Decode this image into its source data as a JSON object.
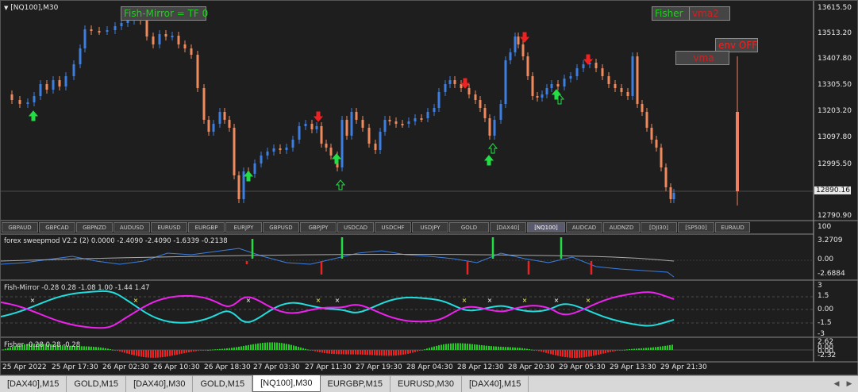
{
  "chart": {
    "title": "[NQ100],M30",
    "current_price": "12890.16",
    "price_axis": [
      "13615.50",
      "13513.20",
      "13407.80",
      "13305.50",
      "13203.20",
      "13097.80",
      "12995.50",
      "12890.16",
      "12790.90"
    ],
    "time_axis": [
      "25 Apr 2022",
      "25 Apr 17:30",
      "26 Apr 02:30",
      "26 Apr 10:30",
      "26 Apr 18:30",
      "27 Apr 03:30",
      "27 Apr 11:30",
      "27 Apr 19:30",
      "28 Apr 04:30",
      "28 Apr 12:30",
      "28 Apr 20:30",
      "29 Apr 05:30",
      "29 Apr 13:30",
      "29 Apr 21:30"
    ],
    "labels": {
      "fish_mirror": "Fish-Mirror = TF 0",
      "fisher": "Fisher",
      "vma2": "vma2",
      "env": "env OFF",
      "vma": "vma"
    },
    "colors": {
      "bull": "#3d7fe0",
      "bear": "#f08a5d",
      "up_arrow": "#22dd44",
      "down_arrow": "#ee2222"
    }
  },
  "symbols": [
    "GBPAUD",
    "GBPCAD",
    "GBPNZD",
    "AUDUSD",
    "EURUSD",
    "EURGBP",
    "EURJPY",
    "GBPUSD",
    "GBPJPY",
    "USDCAD",
    "USDCHF",
    "USDJPY",
    "GOLD",
    "[DAX40]",
    "[NQ100]",
    "AUDCAD",
    "AUDNZD",
    "[DJI30]",
    "[SP500]",
    "EURAUD"
  ],
  "active_symbol": "[NQ100]",
  "indicators": {
    "sweep": {
      "title": "forex sweepmod V2.2 (2) 0.0000 -2.4090 -2.4090 -1.6339 -0.2138",
      "axis": [
        "100",
        "3.2709",
        "0.00",
        "-2.6884"
      ]
    },
    "fish_mirror": {
      "title": "Fish-Mirror -0.28 0.28 -1.08 1.00 -1.44 1.47",
      "axis": [
        "3",
        "1.5",
        "0.00",
        "-1.5",
        "-3"
      ]
    },
    "fisher": {
      "title": "Fisher -0.28 0.28 -0.28",
      "axis": [
        "2.62",
        "0.00",
        "0.00",
        "-2.32"
      ]
    }
  },
  "tabs": [
    "[DAX40],M15",
    "GOLD,M15",
    "[DAX40],M30",
    "GOLD,M15",
    "[NQ100],M30",
    "EURGBP,M15",
    "EURUSD,M30",
    "[DAX40],M15"
  ],
  "active_tab": "[NQ100],M30"
}
